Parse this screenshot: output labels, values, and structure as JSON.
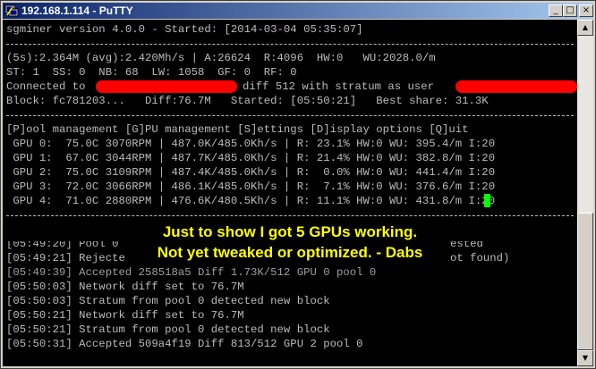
{
  "window": {
    "title": "192.168.1.114 - PuTTY",
    "controls": {
      "minimize": "_",
      "maximize": "□",
      "close": "×"
    },
    "icon": "putty-terminal-icon"
  },
  "terminal": {
    "header": "sgminer version 4.0.0 - Started: [2014-03-04 05:35:07]",
    "stats": {
      "line1": "(5s):2.364M (avg):2.420Mh/s | A:26624  R:4096  HW:0   WU:2028.0/m",
      "line2": "ST: 1  SS: 0  NB: 68  LW: 1058  GF: 0  RF: 0",
      "connected_prefix": "Connected to",
      "connected_mid": "diff 512 with stratum as user",
      "block": "Block: fc781203...   Diff:76.7M   Started: [05:50:21]   Best share: 31.3K"
    },
    "menu": "[P]ool management [G]PU management [S]ettings [D]isplay options [Q]uit",
    "gpus": [
      " GPU 0:  75.0C 3070RPM | 487.0K/485.0Kh/s | R: 23.1% HW:0 WU: 395.4/m I:20",
      " GPU 1:  67.0C 3044RPM | 487.7K/485.0Kh/s | R: 21.4% HW:0 WU: 382.8/m I:20",
      " GPU 2:  75.0C 3109RPM | 487.4K/485.0Kh/s | R:  0.0% HW:0 WU: 441.4/m I:20",
      " GPU 3:  72.0C 3066RPM | 486.1K/485.0Kh/s | R:  7.1% HW:0 WU: 376.6/m I:20",
      " GPU 4:  71.0C 2880RPM | 476.6K/480.5Kh/s | R: 11.1% HW:0 WU: 431.8/m I:20"
    ],
    "log": [
      "[05:49:20] Pool 0",
      "[05:49:21] Rejecte",
      "[05:49:39] Accepted 258518a5 Diff 1.73K/512 GPU 0 pool 0",
      "[05:50:03] Network diff set to 76.7M",
      "[05:50:03] Stratum from pool 0 detected new block",
      "[05:50:21] Network diff set to 76.7M",
      "[05:50:21] Stratum from pool 0 detected new block",
      "[05:50:31] Accepted 509a4f19 Diff 813/512 GPU 2 pool 0"
    ],
    "log_right": {
      "row0": "ested",
      "row1": "ot found)"
    }
  },
  "overlay": {
    "line1": "Just to show I got 5 GPUs working.",
    "line2": "Not yet tweaked or optimized. - Dabs"
  },
  "colors": {
    "terminal_bg": "#000000",
    "terminal_fg": "#bbbbbb",
    "overlay_text": "#ffff00",
    "redaction": "#ff0000",
    "cursor": "#00ff00"
  }
}
